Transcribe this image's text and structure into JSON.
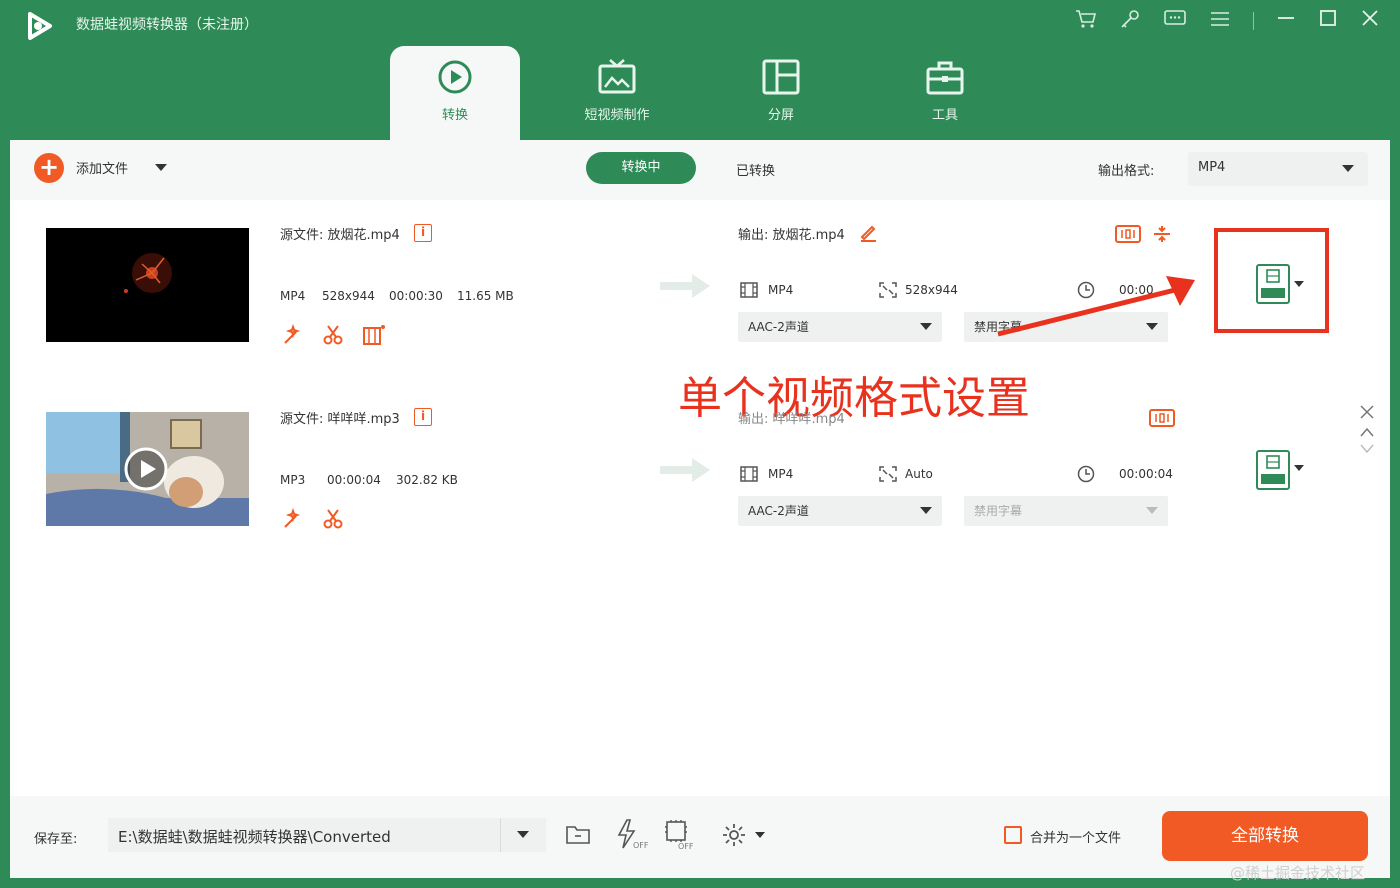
{
  "app": {
    "title": "数据蛙视频转换器（未注册）",
    "brand_color": "#2e8b57",
    "accent_color": "#f15a24"
  },
  "titlebar_icons": [
    "cart-icon",
    "key-icon",
    "chat-icon",
    "menu-icon",
    "minimize-icon",
    "maximize-icon",
    "close-icon"
  ],
  "nav": {
    "tabs": [
      {
        "label": "转换",
        "icon": "convert-icon",
        "active": true
      },
      {
        "label": "短视频制作",
        "icon": "tv-icon",
        "active": false
      },
      {
        "label": "分屏",
        "icon": "split-screen-icon",
        "active": false
      },
      {
        "label": "工具",
        "icon": "toolbox-icon",
        "active": false
      }
    ]
  },
  "toolbar": {
    "add_file_label": "添加文件",
    "converting_label": "转换中",
    "converted_label": "已转换",
    "output_format_label": "输出格式:",
    "output_format_value": "MP4"
  },
  "files": [
    {
      "source_label": "源文件: 放烟花.mp4",
      "format": "MP4",
      "resolution": "528x944",
      "duration": "00:00:30",
      "size": "11.65 MB",
      "output_label": "输出: 放烟花.mp4",
      "out_format": "MP4",
      "out_resolution": "528x944",
      "out_duration": "00:00",
      "audio": "AAC-2声道",
      "subtitle": "禁用字幕"
    },
    {
      "source_label": "源文件: 咩咩咩.mp3",
      "format": "MP3",
      "duration": "00:00:04",
      "size": "302.82 KB",
      "output_label": "输出: 咩咩咩.mp4",
      "out_format": "MP4",
      "out_resolution": "Auto",
      "out_duration": "00:00:04",
      "audio": "AAC-2声道",
      "subtitle": "禁用字幕"
    }
  ],
  "annotation": {
    "text": "单个视频格式设置",
    "color": "#e8321e"
  },
  "footer": {
    "save_to_label": "保存至:",
    "save_path": "E:\\数据蛙\\数据蛙视频转换器\\Converted",
    "merge_label": "合并为一个文件",
    "convert_all_label": "全部转换"
  },
  "watermark": "@稀土掘金技术社区"
}
